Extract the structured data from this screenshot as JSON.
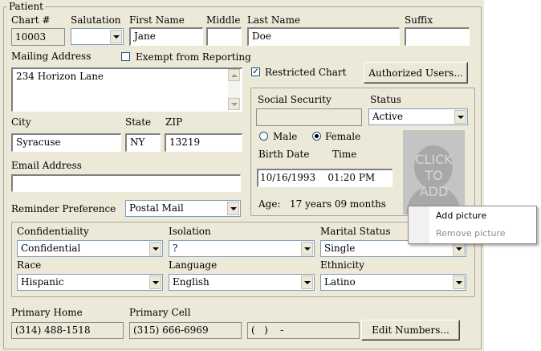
{
  "patient_group": {
    "legend": "Patient",
    "chart_label": "Chart #",
    "chart_value": "10003",
    "salutation_label": "Salutation",
    "salutation_value": "",
    "first_name_label": "First Name",
    "first_name_value": "Jane",
    "middle_label": "Middle",
    "middle_value": "",
    "last_name_label": "Last Name",
    "last_name_value": "Doe",
    "suffix_label": "Suffix",
    "suffix_value": "",
    "mailing_address_label": "Mailing Address",
    "mailing_address_value": "234 Horizon Lane",
    "exempt_label": "Exempt from Reporting",
    "exempt_checked": false,
    "restricted_label": "Restricted Chart",
    "restricted_checked": true,
    "restricted_mark": "✓",
    "authorized_users_button": "Authorized Users...",
    "city_label": "City",
    "city_value": "Syracuse",
    "state_label": "State",
    "state_value": "NY",
    "zip_label": "ZIP",
    "zip_value": "13219",
    "email_label": "Email Address",
    "email_value": "",
    "reminder_label": "Reminder Preference",
    "reminder_value": "Postal Mail"
  },
  "demographics_panel": {
    "ssn_label": "Social Security",
    "ssn_value": "",
    "status_label": "Status",
    "status_value": "Active",
    "male_label": "Male",
    "female_label": "Female",
    "sex_selected": "Female",
    "birth_date_label": "Birth Date",
    "time_label": "Time",
    "birth_value": "10/16/1993    01:20 PM",
    "age_label": "Age:",
    "age_value": "17 years 09 months",
    "photo_text": [
      "CLICK",
      "TO",
      "ADD"
    ]
  },
  "context_menu": {
    "items": [
      {
        "label": "Add picture",
        "enabled": true
      },
      {
        "label": "Remove picture",
        "enabled": false
      }
    ]
  },
  "privacy_group": {
    "confidentiality_label": "Confidentiality",
    "confidentiality_value": "Confidential",
    "isolation_label": "Isolation",
    "isolation_value": "?",
    "marital_label": "Marital Status",
    "marital_value": "Single",
    "race_label": "Race",
    "race_value": "Hispanic",
    "language_label": "Language",
    "language_value": "English",
    "ethnicity_label": "Ethnicity",
    "ethnicity_value": "Latino"
  },
  "phones": {
    "home_label": "Primary Home",
    "home_value": "(314) 488-1518",
    "cell_label": "Primary Cell",
    "cell_value": "(315) 666-6969",
    "other_value": "(   )    -",
    "edit_button": "Edit Numbers..."
  },
  "colors": {
    "window_bg": "#ece9d8",
    "field_border": "#7f9db9",
    "menu_disabled": "#8d8d8d"
  }
}
